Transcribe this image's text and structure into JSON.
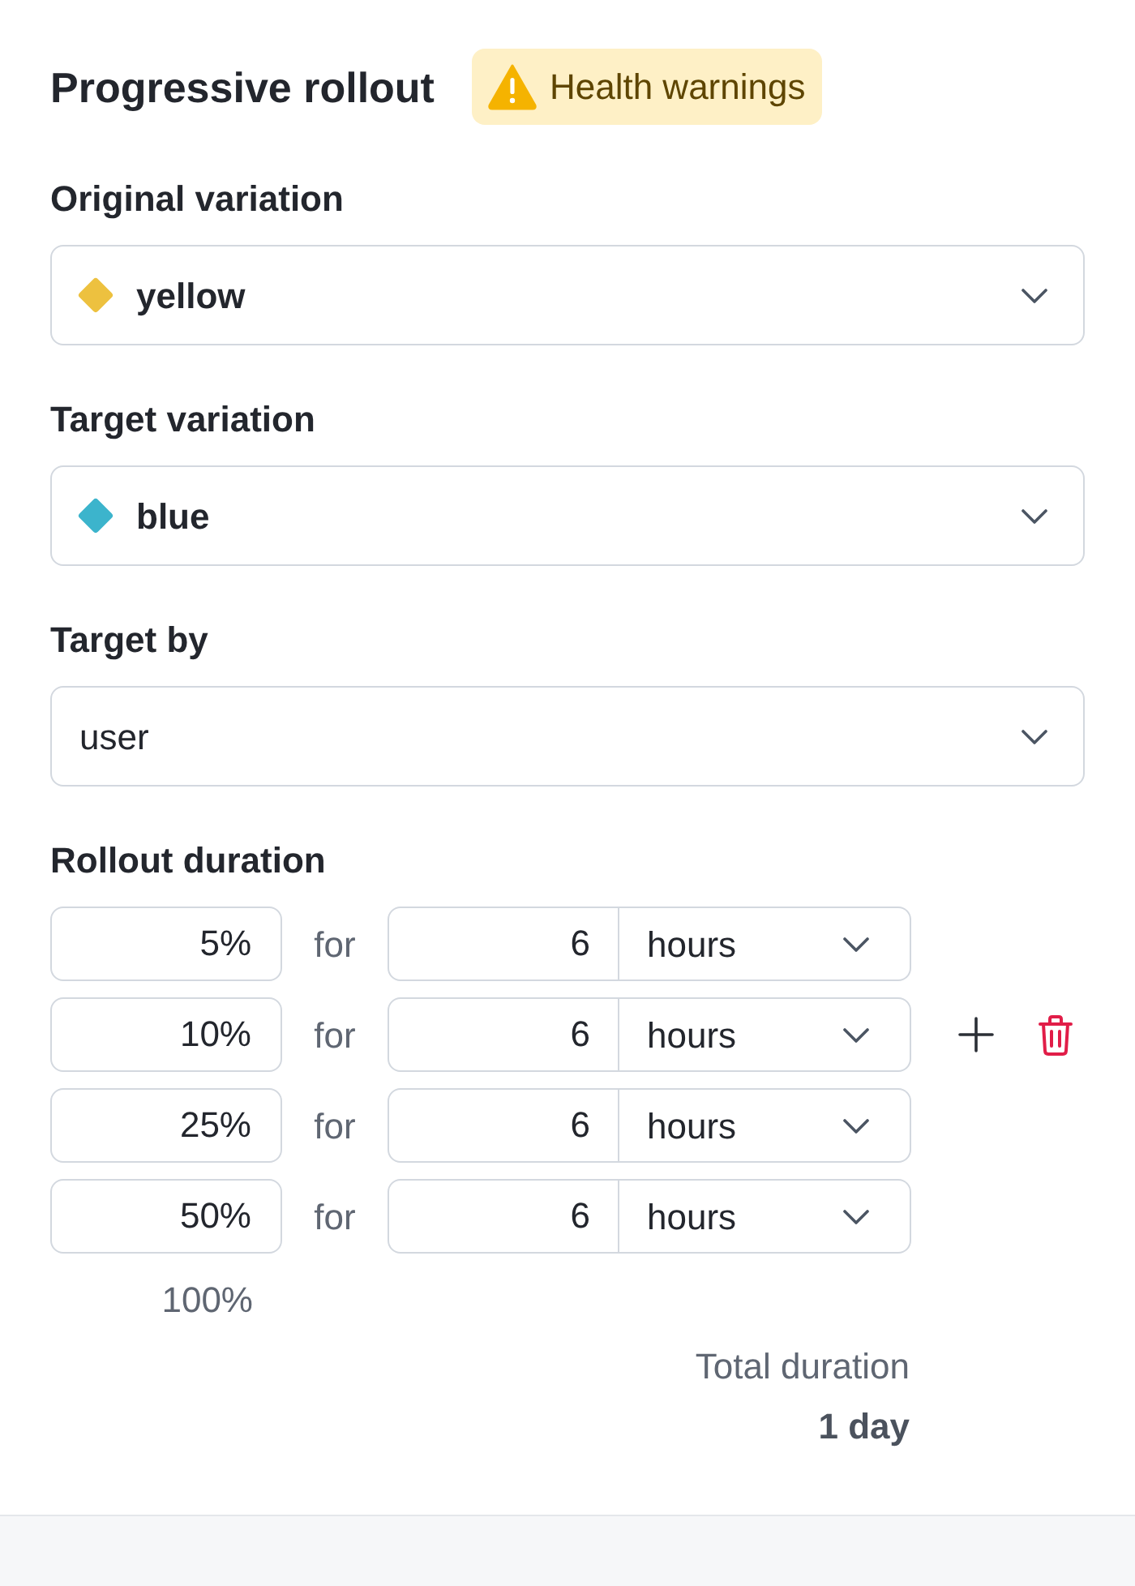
{
  "header": {
    "title": "Progressive rollout",
    "badge": {
      "label": "Health warnings"
    }
  },
  "fields": [
    {
      "label": "Original variation",
      "kind": "variation",
      "value": "yellow",
      "color": "#edc13f"
    },
    {
      "label": "Target variation",
      "kind": "variation",
      "value": "blue",
      "color": "#3cb4cc"
    },
    {
      "label": "Target by",
      "kind": "plain",
      "value": "user"
    }
  ],
  "rollout": {
    "label": "Rollout duration",
    "steps": [
      {
        "percent": "5%",
        "connector": "for",
        "amount": "6",
        "unit": "hours",
        "hovered": false
      },
      {
        "percent": "10%",
        "connector": "for",
        "amount": "6",
        "unit": "hours",
        "hovered": true
      },
      {
        "percent": "25%",
        "connector": "for",
        "amount": "6",
        "unit": "hours",
        "hovered": false
      },
      {
        "percent": "50%",
        "connector": "for",
        "amount": "6",
        "unit": "hours",
        "hovered": false
      }
    ],
    "final_percent": "100%",
    "total": {
      "label": "Total duration",
      "value": "1 day"
    }
  }
}
